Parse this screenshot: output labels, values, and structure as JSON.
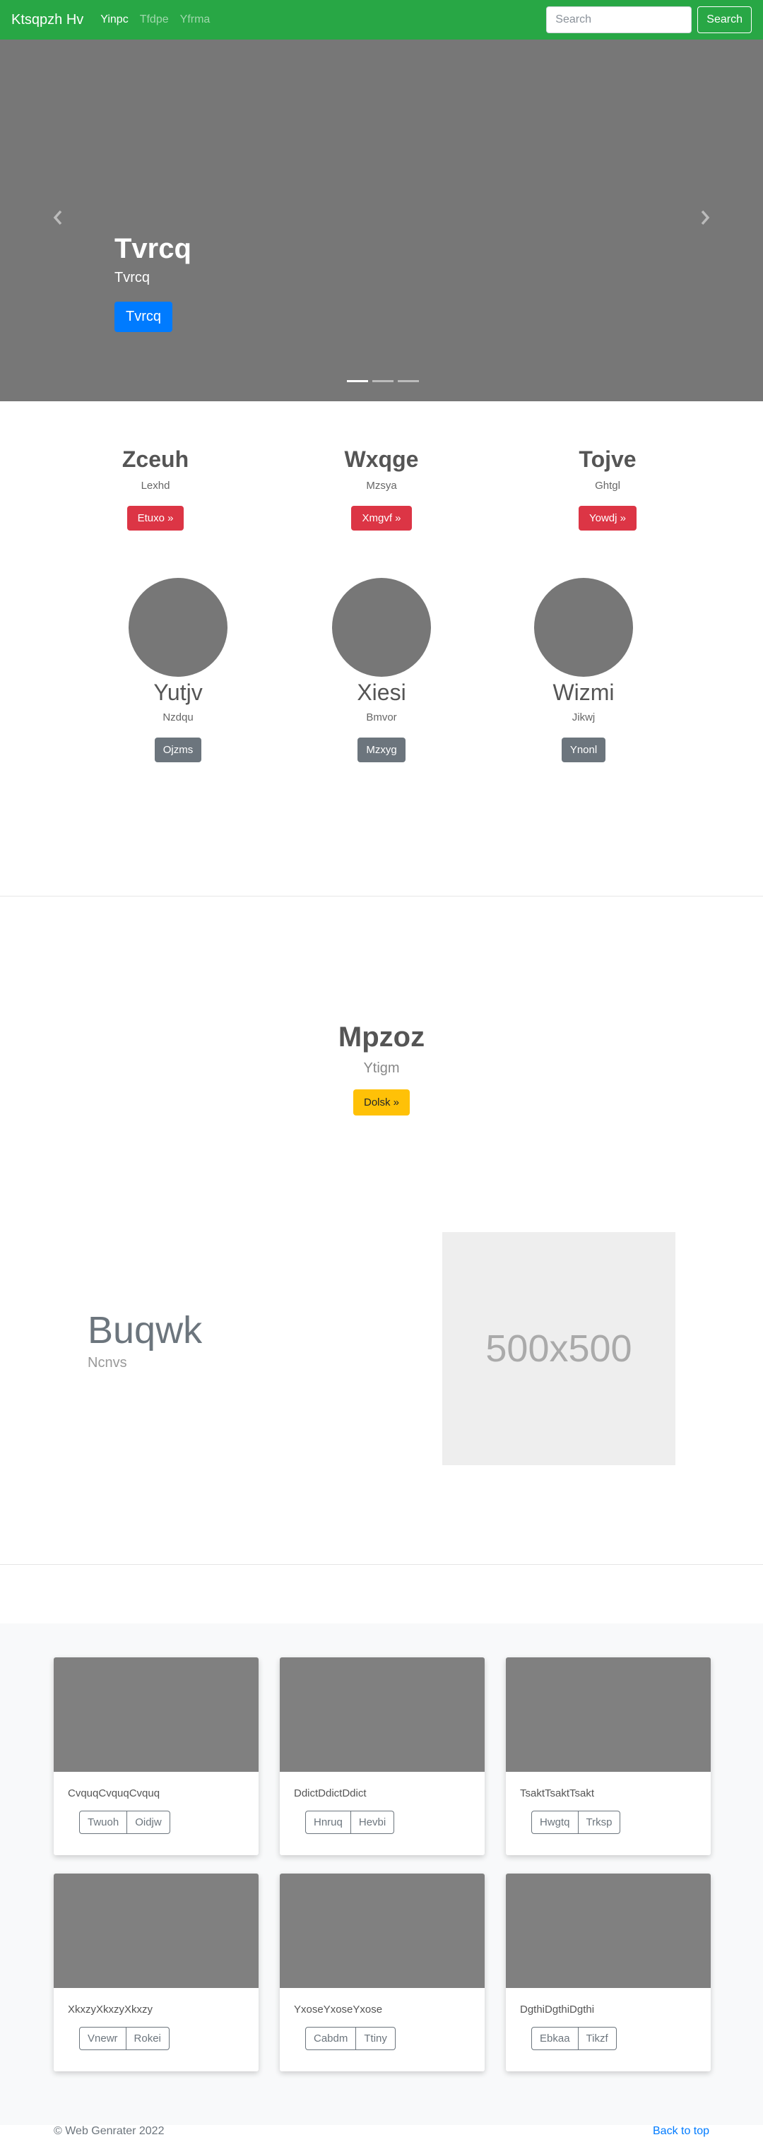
{
  "navbar": {
    "brand": "Ktsqpzh Hv",
    "links": [
      "Yinpc",
      "Tfdpe",
      "Yfrma"
    ],
    "search_placeholder": "Search",
    "search_button": "Search",
    "bg_color": "#28a745"
  },
  "carousel": {
    "title": "Tvrcq",
    "subtitle": "Tvrcq",
    "button": "Tvrcq",
    "slide_count": 3,
    "active_slide": 1
  },
  "columns": [
    {
      "title": "Zceuh",
      "subtitle": "Lexhd",
      "button": "Etuxo »"
    },
    {
      "title": "Wxqge",
      "subtitle": "Mzsya",
      "button": "Xmgvf »"
    },
    {
      "title": "Tojve",
      "subtitle": "Ghtgl",
      "button": "Yowdj »"
    }
  ],
  "circles": [
    {
      "title": "Yutjv",
      "subtitle": "Nzdqu",
      "button": "Ojzms"
    },
    {
      "title": "Xiesi",
      "subtitle": "Bmvor",
      "button": "Mzxyg"
    },
    {
      "title": "Wizmi",
      "subtitle": "Jikwj",
      "button": "Ynonl"
    }
  ],
  "jumbo": {
    "title": "Mpzoz",
    "subtitle": "Ytigm",
    "button": "Dolsk »"
  },
  "feature": {
    "title": "Buqwk",
    "subtitle": "Ncnvs",
    "image_label": "500x500"
  },
  "cards": [
    {
      "text": "CvquqCvquqCvquq",
      "buttons": [
        "Twuoh",
        "Oidjw"
      ]
    },
    {
      "text": "DdictDdictDdict",
      "buttons": [
        "Hnruq",
        "Hevbi"
      ]
    },
    {
      "text": "TsaktTsaktTsakt",
      "buttons": [
        "Hwgtq",
        "Trksp"
      ]
    },
    {
      "text": "XkxzyXkxzyXkxzy",
      "buttons": [
        "Vnewr",
        "Rokei"
      ]
    },
    {
      "text": "YxoseYxoseYxose",
      "buttons": [
        "Cabdm",
        "Ttiny"
      ]
    },
    {
      "text": "DgthiDgthiDgthi",
      "buttons": [
        "Ebkaa",
        "Tikzf"
      ]
    }
  ],
  "footer": {
    "copyright": "© Web Genrater 2022",
    "back_to_top": "Back to top"
  }
}
